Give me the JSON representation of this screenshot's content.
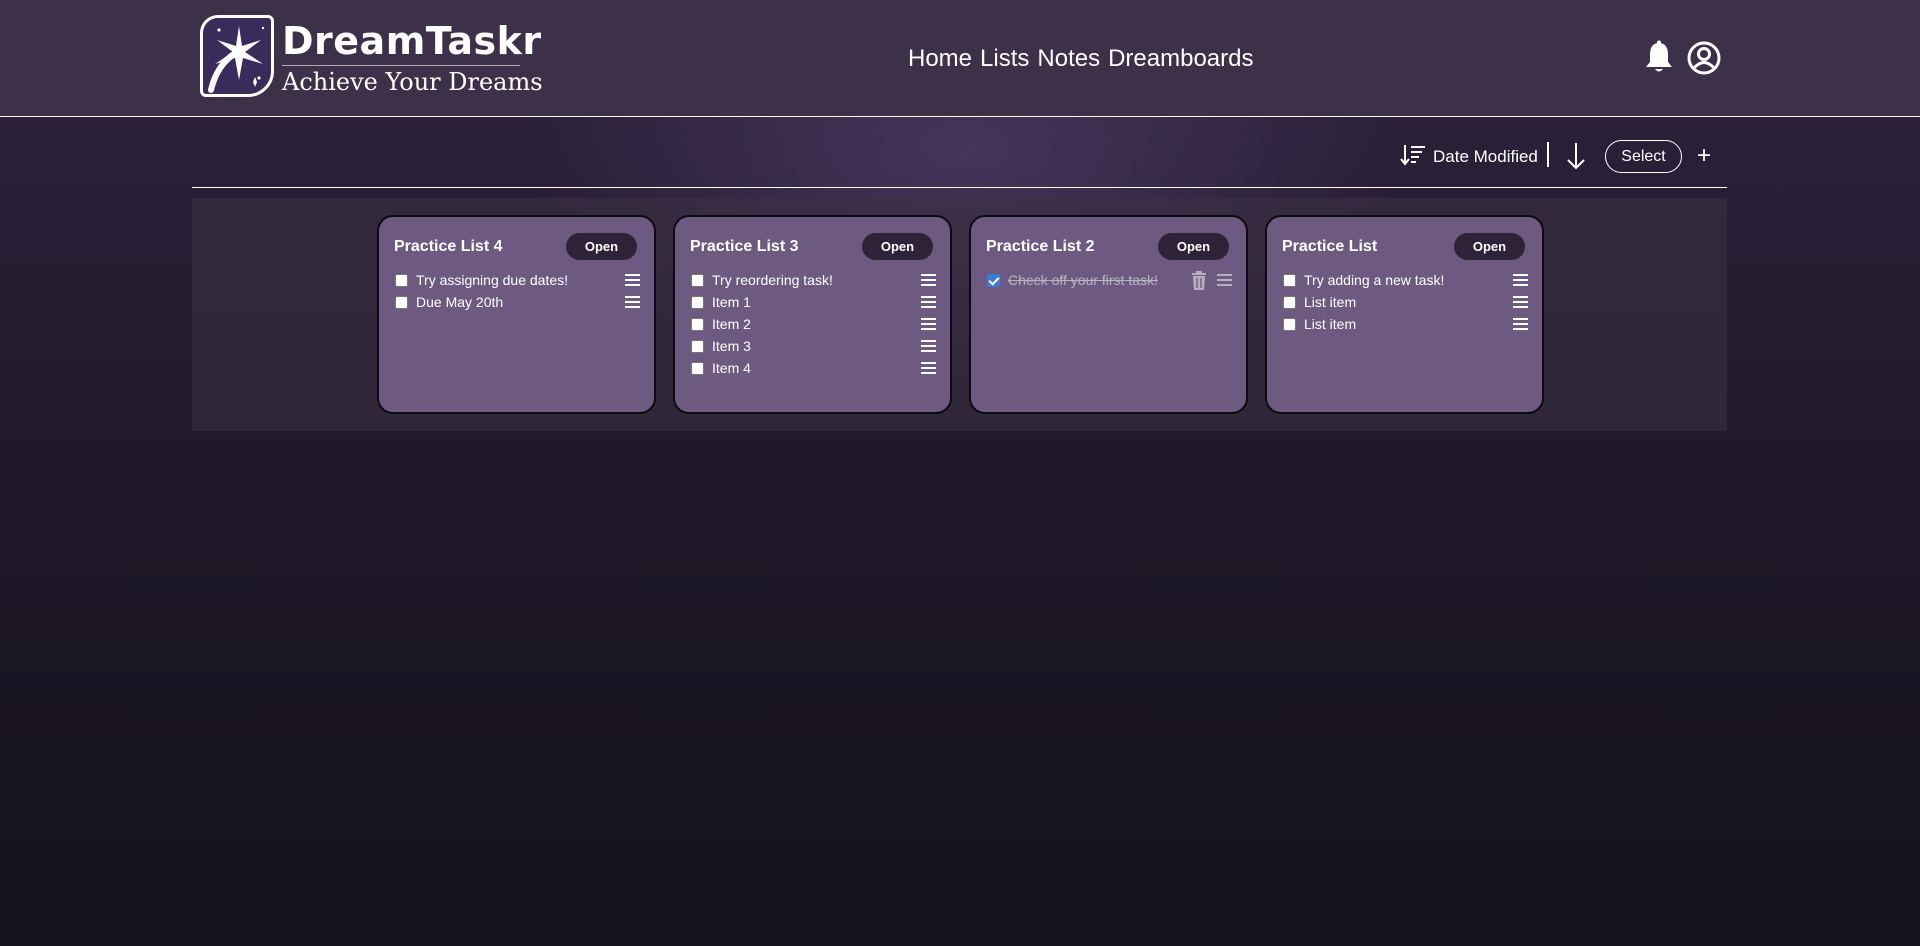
{
  "brand": {
    "name": "DreamTaskr",
    "tagline": "Achieve Your Dreams"
  },
  "nav": {
    "items": [
      {
        "label": "Home"
      },
      {
        "label": "Lists"
      },
      {
        "label": "Notes"
      },
      {
        "label": "Dreamboards"
      }
    ]
  },
  "header_icons": [
    "bell-icon",
    "user-icon"
  ],
  "toolbar": {
    "sort_label": "Date Modified",
    "sort_direction_icon": "arrow-down-icon",
    "select_label": "Select",
    "add_label": "+"
  },
  "lists": [
    {
      "title": "Practice List 4",
      "open_label": "Open",
      "items": [
        {
          "text": "Try assigning due dates!",
          "checked": false
        },
        {
          "text": "Due May 20th",
          "checked": false
        }
      ]
    },
    {
      "title": "Practice List 3",
      "open_label": "Open",
      "items": [
        {
          "text": "Try reordering task!",
          "checked": false
        },
        {
          "text": "Item 1",
          "checked": false
        },
        {
          "text": "Item 2",
          "checked": false
        },
        {
          "text": "Item 3",
          "checked": false
        },
        {
          "text": "Item 4",
          "checked": false
        }
      ]
    },
    {
      "title": "Practice List 2",
      "open_label": "Open",
      "items": [
        {
          "text": "Check off your first task!",
          "checked": true
        }
      ]
    },
    {
      "title": "Practice List",
      "open_label": "Open",
      "items": [
        {
          "text": "Try adding a new task!",
          "checked": false
        },
        {
          "text": "List item",
          "checked": false
        },
        {
          "text": "List item",
          "checked": false
        }
      ]
    }
  ],
  "colors": {
    "header_bg": "#3d3049",
    "card_bg": "#6e5a80",
    "button_dark": "#2e2338",
    "checkbox_checked": "#3a7bd5"
  }
}
